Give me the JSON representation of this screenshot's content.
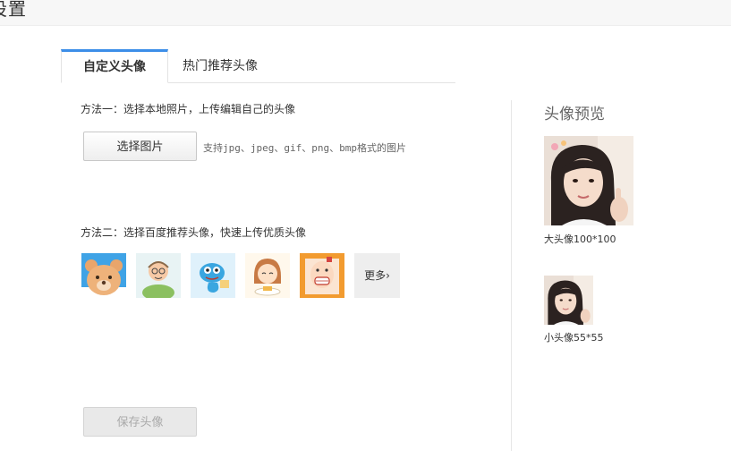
{
  "header": {
    "title": "设置"
  },
  "tabs": [
    {
      "label": "自定义头像",
      "active": true
    },
    {
      "label": "热门推荐头像",
      "active": false
    }
  ],
  "method1": {
    "label": "方法一：选择本地照片，上传编辑自己的头像",
    "button": "选择图片",
    "hint": "支持jpg、jpeg、gif、png、bmp格式的图片"
  },
  "method2": {
    "label": "方法二：选择百度推荐头像，快速上传优质头像",
    "avatars": [
      "bear-avatar",
      "grandpa-avatar",
      "blue-fish-avatar",
      "girl-eating-avatar",
      "bald-man-avatar"
    ],
    "more": "更多"
  },
  "save": {
    "label": "保存头像"
  },
  "preview": {
    "title": "头像预览",
    "big_caption": "大头像100*100",
    "small_caption": "小头像55*55"
  },
  "colors": {
    "accent": "#3c8ee8",
    "divider": "#e6e6e6"
  }
}
